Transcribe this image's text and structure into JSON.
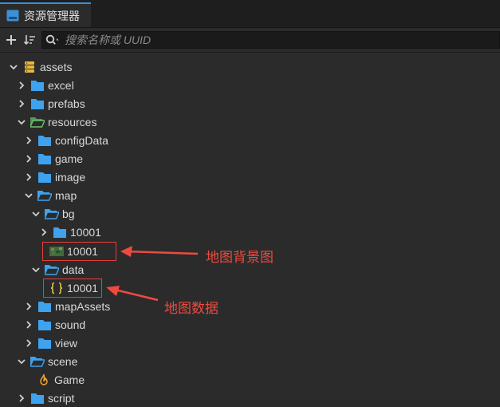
{
  "panel": {
    "title": "资源管理器"
  },
  "toolbar": {
    "search_placeholder": "搜索名称或 UUID"
  },
  "tree": {
    "assets": "assets",
    "excel": "excel",
    "prefabs": "prefabs",
    "resources": "resources",
    "configData": "configData",
    "game": "game",
    "image": "image",
    "map": "map",
    "bg": "bg",
    "bg_folder_10001": "10001",
    "bg_image_10001": "10001",
    "data": "data",
    "data_json_10001": "10001",
    "mapAssets": "mapAssets",
    "sound": "sound",
    "view": "view",
    "scene": "scene",
    "scene_game": "Game",
    "script": "script"
  },
  "annotations": {
    "bg_image": "地图背景图",
    "map_data": "地图数据"
  },
  "colors": {
    "folder": "#3fa2ef",
    "resources_folder": "#6cc36f",
    "accent": "#3d8fd6",
    "annotation": "#ef4a3f",
    "json_brace": "#e6c04d",
    "scene_flame": "#f0a030"
  }
}
